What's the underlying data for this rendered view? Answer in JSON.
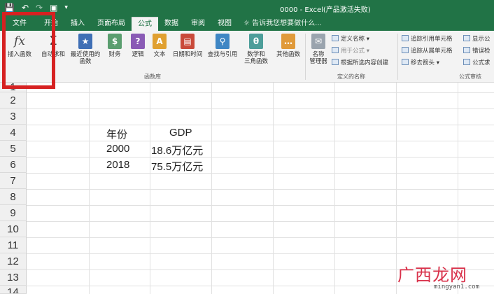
{
  "title_bar": {
    "document_title": "0000 - Excel(产品激活失败)",
    "qat": [
      "save-icon",
      "undo-icon",
      "redo-icon",
      "camera-icon",
      "customize-icon"
    ]
  },
  "tabs": [
    "文件",
    "开始",
    "插入",
    "页面布局",
    "公式",
    "数据",
    "审阅",
    "视图"
  ],
  "active_tab": "公式",
  "tell_me": "告诉我您想要做什么...",
  "ribbon": {
    "function_library": {
      "insert_function": "插入函数",
      "autosum": "自动求和",
      "recent_1": "最近使用的",
      "recent_2": "函数",
      "financial": "财务",
      "logical": "逻辑",
      "text": "文本",
      "datetime": "日期和时间",
      "lookup": "查找与引用",
      "math_1": "数学和",
      "math_2": "三角函数",
      "more": "其他函数",
      "label": "函数库"
    },
    "defined_names": {
      "name_manager_1": "名称",
      "name_manager_2": "管理器",
      "define_name": "定义名称",
      "use_in_formula": "用于公式",
      "create_from_selection": "根据所选内容创建",
      "label": "定义的名称"
    },
    "formula_auditing": {
      "trace_precedents": "追踪引用单元格",
      "trace_dependents": "追踪从属单元格",
      "remove_arrows": "移去箭头",
      "show_formulas": "显示公",
      "error_checking": "错误检",
      "evaluate": "公式求",
      "label": "公式审核"
    }
  },
  "rows": [
    "1",
    "2",
    "3",
    "4",
    "5",
    "6",
    "7",
    "8",
    "9",
    "10",
    "11",
    "12",
    "13",
    "14"
  ],
  "cells": {
    "c4": "年份",
    "d4": "GDP",
    "c5": "2000",
    "d5": "18.6万亿元",
    "c6": "2018",
    "d6": "75.5万亿元"
  },
  "watermark": {
    "text": "广西龙网",
    "url": "mingyan1.com"
  },
  "colors": {
    "excel_green": "#217346",
    "highlight_red": "#d62121"
  }
}
